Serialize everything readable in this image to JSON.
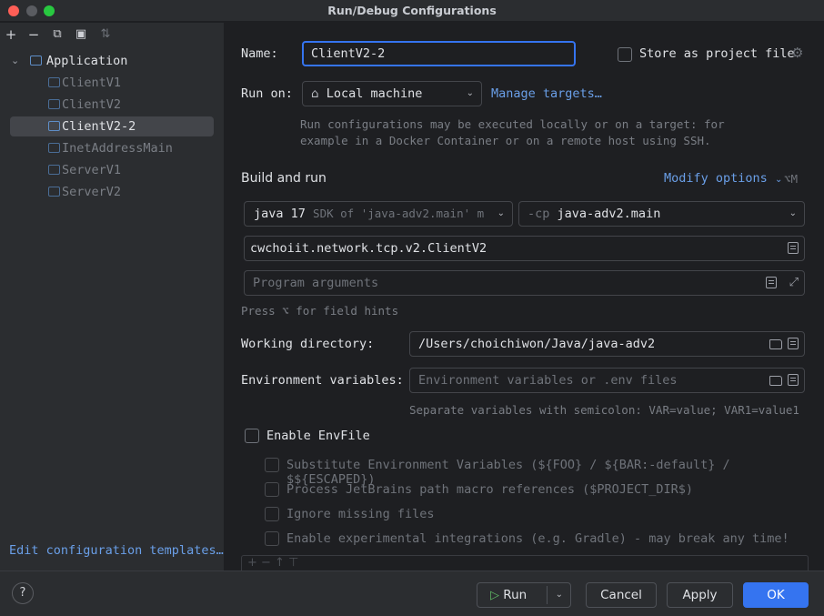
{
  "window": {
    "title": "Run/Debug Configurations"
  },
  "sidebar": {
    "toolbar": [
      {
        "name": "add-icon",
        "glyph": "+"
      },
      {
        "name": "remove-icon",
        "glyph": "−"
      },
      {
        "name": "copy-icon",
        "glyph": "⧉"
      },
      {
        "name": "new-folder-icon",
        "glyph": "▣"
      },
      {
        "name": "sort-icon",
        "glyph": "⇅"
      }
    ],
    "root": {
      "label": "Application",
      "chevron": "⌄"
    },
    "items": [
      {
        "label": "ClientV1"
      },
      {
        "label": "ClientV2"
      },
      {
        "label": "ClientV2-2"
      },
      {
        "label": "InetAddressMain"
      },
      {
        "label": "ServerV1"
      },
      {
        "label": "ServerV2"
      }
    ],
    "edit_templates": "Edit configuration templates…"
  },
  "form": {
    "name_label": "Name:",
    "name_value": "ClientV2-2",
    "store_label": "Store as project file",
    "store_icon": "⚙",
    "run_on_label": "Run on:",
    "run_on_value": "Local machine",
    "run_on_icon": "⌂",
    "manage_targets": "Manage targets…",
    "run_on_hint_1": "Run configurations may be executed locally or on a target: for",
    "run_on_hint_2": "example in a Docker Container or on a remote host using SSH.",
    "build_run_label": "Build and run",
    "modify_options": "Modify options",
    "modify_shortcut": "⌥M",
    "jdk_bold": "java 17",
    "jdk_dim": "SDK of 'java-adv2.main' m",
    "cp_prefix": "-cp",
    "cp_value": "java-adv2.main",
    "main_class": "cwchoiit.network.tcp.v2.ClientV2",
    "program_args_placeholder": "Program arguments",
    "field_hint": "Press ⌥ for field hints",
    "working_dir_label": "Working directory:",
    "working_dir_value": "/Users/choichiwon/Java/java-adv2",
    "env_label": "Environment variables:",
    "env_placeholder": "Environment variables or .env files",
    "env_hint": "Separate variables with semicolon: VAR=value; VAR1=value1",
    "envfile_label": "Enable EnvFile",
    "envfile_options": [
      {
        "label": "Substitute Environment Variables (${FOO} / ${BAR:-default} / $${ESCAPED})"
      },
      {
        "label": "Process JetBrains path macro references ($PROJECT_DIR$)"
      },
      {
        "label": "Ignore missing files"
      },
      {
        "label": "Enable experimental integrations (e.g. Gradle) - may break any time!"
      }
    ],
    "table_toolbar": "+  −  ↑  ⊤"
  },
  "footer": {
    "help": "?",
    "run": "Run",
    "cancel": "Cancel",
    "apply": "Apply",
    "ok": "OK"
  },
  "colors": {
    "accent": "#3574f0",
    "link": "#6a9fe8",
    "background": "#1e1f22",
    "panel": "#2b2d30"
  }
}
